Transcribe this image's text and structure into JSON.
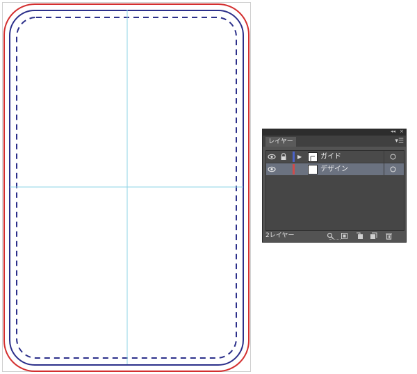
{
  "artboard": {
    "colors": {
      "trim_red": "#d32f2f",
      "border_navy": "#2b2f8a",
      "dashed_navy": "#2b2f8a",
      "guide_cyan": "#8ed3e6"
    }
  },
  "layers_panel": {
    "top_buttons": {
      "collapse_label": "◂◂",
      "close_label": "×"
    },
    "tab_label": "レイヤー",
    "menu_label": "▾☰",
    "layers": [
      {
        "name": "ガイド",
        "color": "#4a62c8",
        "selected": false,
        "locked": true,
        "expanded_icon": "▶"
      },
      {
        "name": "デザイン",
        "color": "#d04a4a",
        "selected": true,
        "locked": false
      }
    ],
    "footer": {
      "count_label": "2レイヤー",
      "icons": [
        "locate-object-icon",
        "clipping-mask-icon",
        "new-sublayer-icon",
        "new-layer-icon",
        "delete-icon"
      ]
    }
  }
}
